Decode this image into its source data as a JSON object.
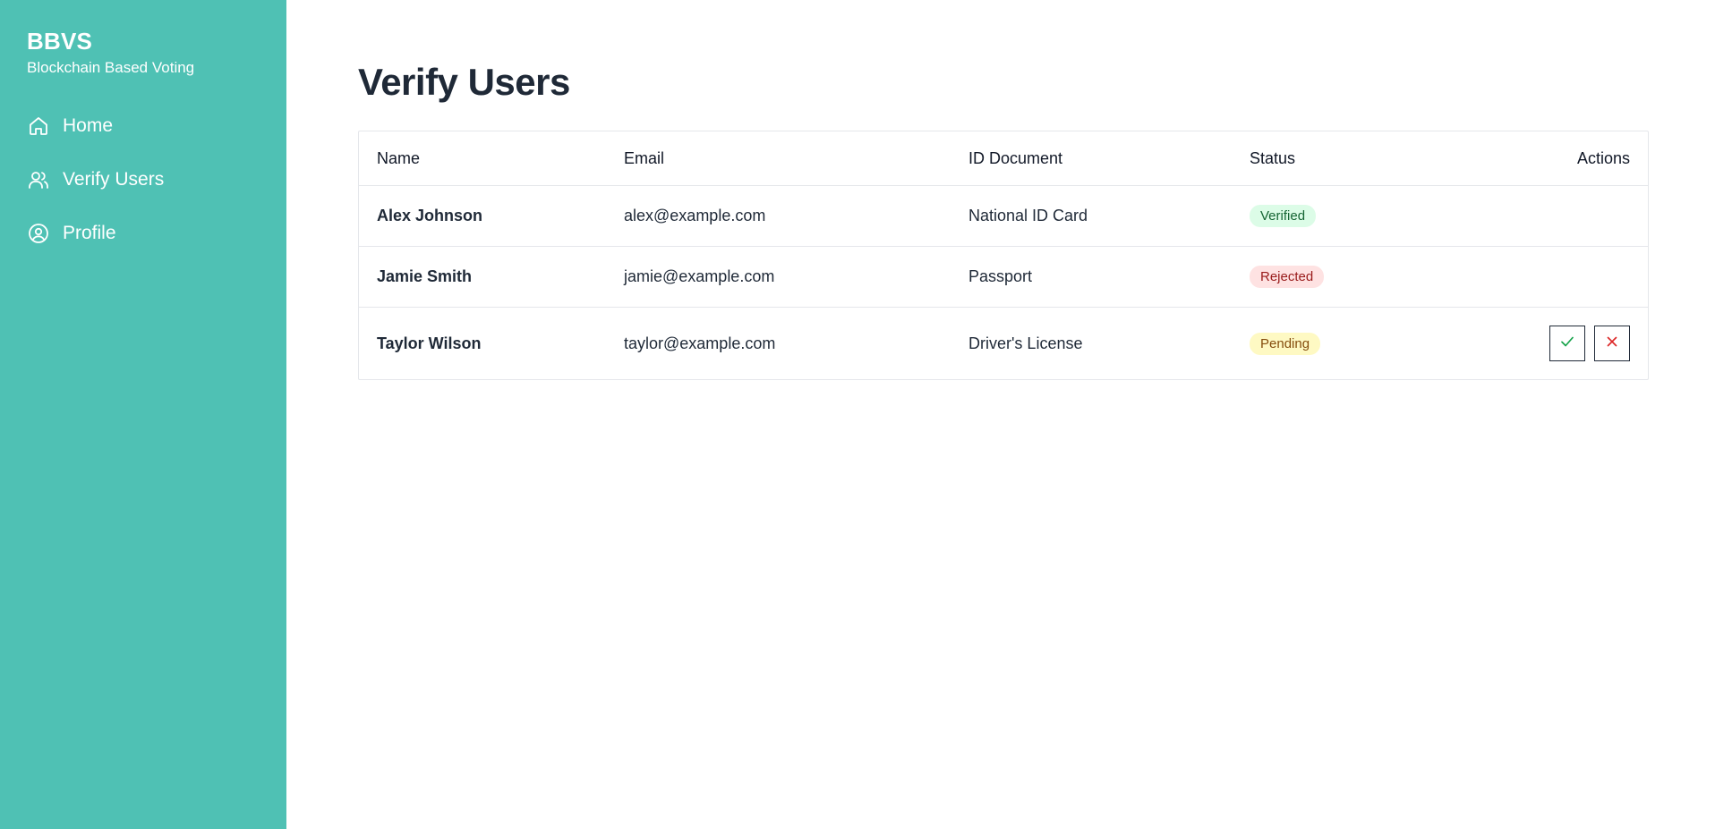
{
  "sidebar": {
    "brand_title": "BBVS",
    "brand_subtitle": "Blockchain Based Voting",
    "items": [
      {
        "label": "Home",
        "icon": "home-icon"
      },
      {
        "label": "Verify Users",
        "icon": "users-icon"
      },
      {
        "label": "Profile",
        "icon": "user-circle-icon"
      }
    ]
  },
  "page": {
    "title": "Verify Users"
  },
  "table": {
    "headers": {
      "name": "Name",
      "email": "Email",
      "document": "ID Document",
      "status": "Status",
      "actions": "Actions"
    },
    "rows": [
      {
        "name": "Alex Johnson",
        "email": "alex@example.com",
        "document": "National ID Card",
        "status": "Verified"
      },
      {
        "name": "Jamie Smith",
        "email": "jamie@example.com",
        "document": "Passport",
        "status": "Rejected"
      },
      {
        "name": "Taylor Wilson",
        "email": "taylor@example.com",
        "document": "Driver's License",
        "status": "Pending"
      }
    ]
  },
  "colors": {
    "sidebar_bg": "#4fc1b4",
    "verified_bg": "#dcfce7",
    "verified_text": "#166534",
    "rejected_bg": "#fee2e2",
    "rejected_text": "#991b1b",
    "pending_bg": "#fef9c3",
    "pending_text": "#854d0e",
    "approve_icon": "#16a34a",
    "reject_icon": "#dc2626"
  }
}
